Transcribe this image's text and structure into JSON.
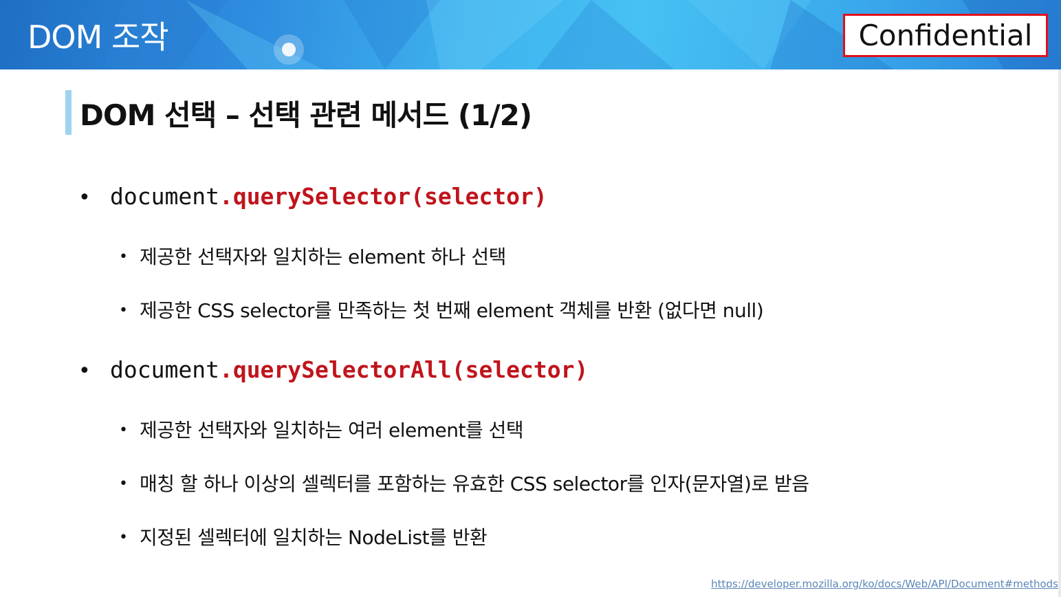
{
  "header": {
    "title": "DOM 조작",
    "badge": "Confidential"
  },
  "slide": {
    "title": "DOM 선택 – 선택 관련 메서드 (1/2)",
    "sections": [
      {
        "object": "document",
        "method": ".querySelector(selector)",
        "points": [
          "제공한 선택자와 일치하는 element 하나 선택",
          "제공한 CSS selector를 만족하는 첫 번째 element 객체를 반환 (없다면 null)"
        ]
      },
      {
        "object": "document",
        "method": ".querySelectorAll(selector)",
        "points": [
          "제공한 선택자와 일치하는 여러 element를 선택",
          "매칭 할 하나 이상의 셀렉터를 포함하는 유효한 CSS selector를 인자(문자열)로 받음",
          "지정된 셀렉터에 일치하는 NodeList를 반환"
        ]
      }
    ],
    "bullet_glyph": "•",
    "reference_link": "https://developer.mozilla.org/ko/docs/Web/API/Document#methods"
  },
  "colors": {
    "method_text": "#c0141c",
    "badge_border": "#e0101a",
    "title_accent": "#9fd3ef",
    "header_blue": "#3fb3ee"
  }
}
